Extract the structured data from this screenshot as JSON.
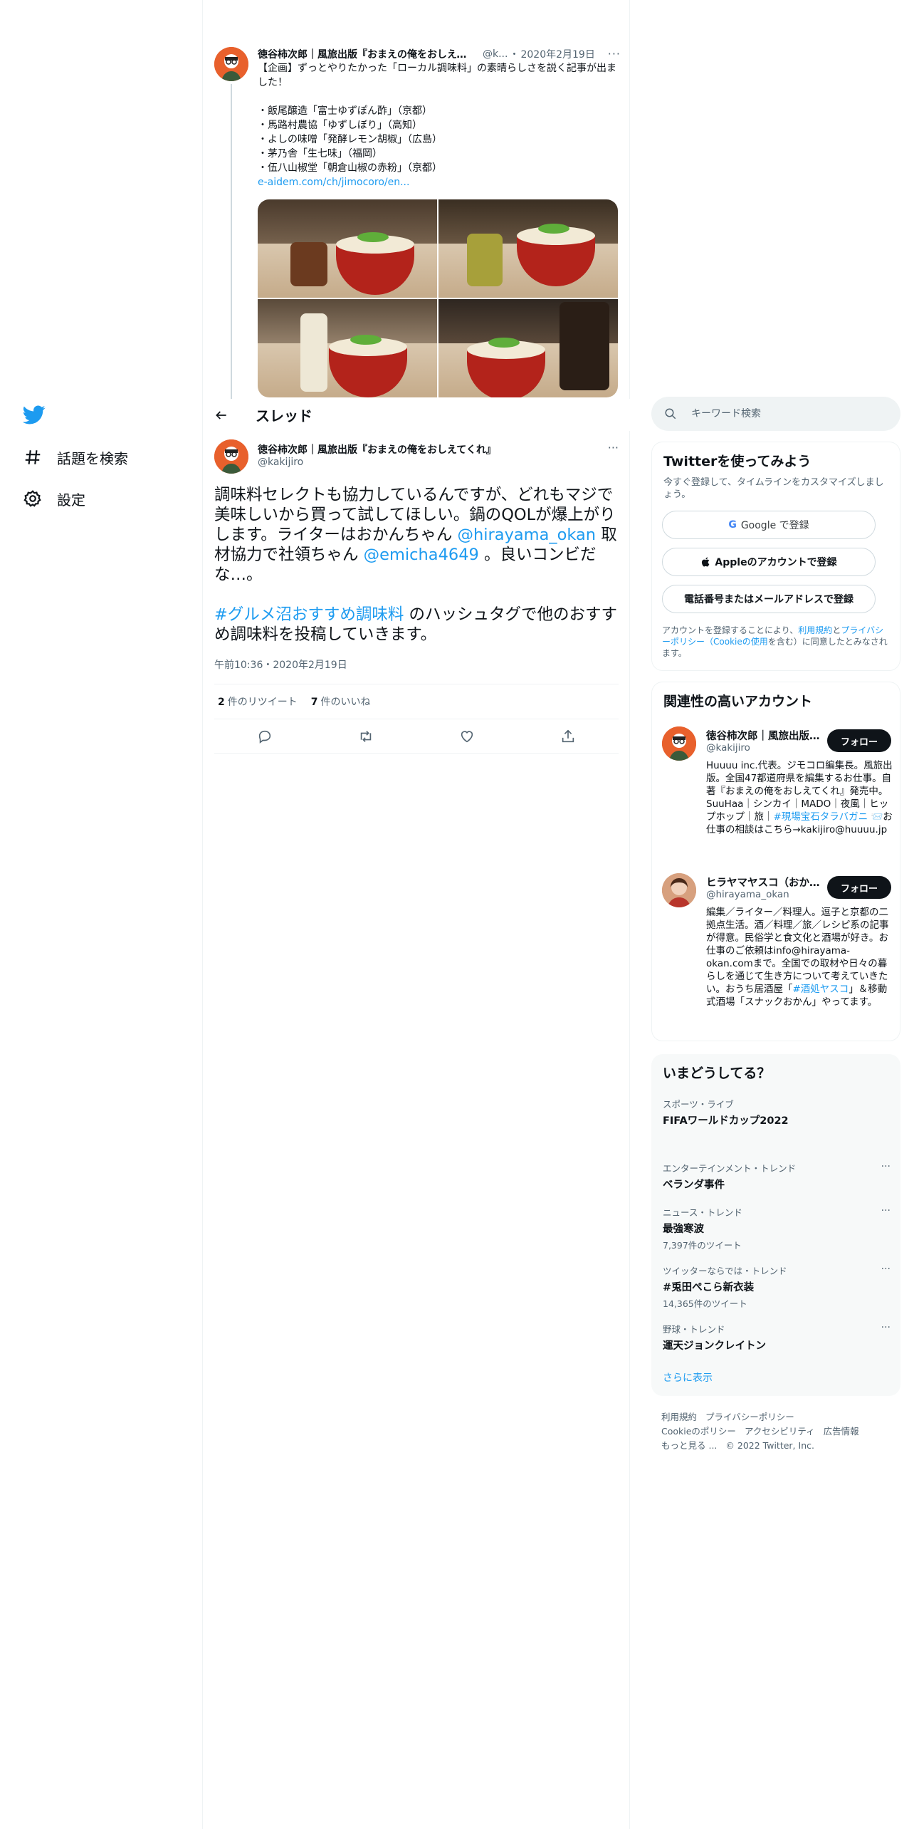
{
  "nav": {
    "items": [
      {
        "label": "話題を検索",
        "icon": "hashtag-icon"
      },
      {
        "label": "設定",
        "icon": "gear-icon"
      }
    ]
  },
  "parent_tweet": {
    "name": "徳谷柿次郎｜風旅出版『おまえの俺をおしえてくれ』",
    "handle": "@k...",
    "separator": "・",
    "date": "2020年2月19日",
    "more": "···",
    "text": "【企画】ずっとやりたかった「ローカル調味料」の素晴らしさを説く記事が出ました！\n\n・飯尾醸造「富士ゆずぽん酢」（京都）\n・馬路村農協「ゆずしぼり」（高知）\n・よしの味噌「発酵レモン胡椒」（広島）\n・茅乃舎「生七味」（福岡）\n・伍八山椒堂「朝倉山椒の赤粉」（京都）",
    "link": "e-aidem.com/ch/jimocoro/en..."
  },
  "header": {
    "title": "スレッド"
  },
  "main_tweet": {
    "name": "徳谷柿次郎｜風旅出版『おまえの俺をおしえてくれ』",
    "handle": "@kakijiro",
    "more": "···",
    "text_p1_a": "調味料セレクトも協力しているんですが、どれもマジで美味しいから買って試してほしい。鍋のQOLが爆上がりします。ライターはおかんちゃん ",
    "mention1": "@hirayama_okan",
    "text_p1_b": " 取材協力で社領ちゃん ",
    "mention2": "@emicha4649",
    "text_p1_c": " 。良いコンビだな…。",
    "hashtag": "#グルメ沼おすすめ調味料",
    "text_p2": " のハッシュタグで他のおすすめ調味料を投稿していきます。",
    "time": "午前10:36",
    "separator": "・",
    "date": "2020年2月19日",
    "retweets": "2",
    "retweets_label": "件のリツイート",
    "likes": "7",
    "likes_label": "件のいいね"
  },
  "search": {
    "placeholder": "キーワード検索"
  },
  "signup": {
    "title": "Twitterを使ってみよう",
    "subtitle": "今すぐ登録して、タイムラインをカスタマイズしましょう。",
    "google_logo": "G",
    "google": "Google で登録",
    "apple": "Appleのアカウントで登録",
    "phone": "電話番号またはメールアドレスで登録",
    "terms_a": "アカウントを登録することにより、",
    "terms_link1": "利用規約",
    "terms_b": "と",
    "terms_link2": "プライバシーポリシー（Cookieの使用",
    "terms_c": "を含む）に同意したとみなされます。"
  },
  "related": {
    "title": "関連性の高いアカウント",
    "follow": "フォロー",
    "accounts": [
      {
        "name": "徳谷柿次郎｜風旅出版『おまえの俺をおしえてくれ』",
        "handle": "@kakijiro",
        "bio_a": "Huuuu inc.代表。ジモコロ編集長。風旅出版。全国47都道府県を編集するお仕事。自著『おまえの俺をおしえてくれ』発売中。SuuHaa｜シンカイ｜MADO｜夜風｜ヒップホップ｜旅｜",
        "bio_tag": "#現場宝石タラバガニ",
        "bio_b": " 📨お仕事の相談はこちら→kakijiro@huuuu.jp"
      },
      {
        "name": "ヒラヤマヤスコ（おかん）",
        "handle": "@hirayama_okan",
        "bio_a": "編集／ライター／料理人。逗子と京都の二拠点生活。酒／料理／旅／レシピ系の記事が得意。民俗学と食文化と酒場が好き。お仕事のご依頼はinfo@hirayama-okan.comまで。全国での取材や日々の暮らしを通じて生き方について考えていきたい。おうち居酒屋「",
        "bio_tag": "#酒処ヤスコ",
        "bio_b": "」＆移動式酒場「スナックおかん」やってます。"
      }
    ]
  },
  "trends": {
    "title": "いまどうしてる？",
    "more": "···",
    "items": [
      {
        "category": "スポーツ・ライブ",
        "name": "FIFAワールドカップ2022",
        "count": ""
      },
      {
        "category": "エンターテインメント・トレンド",
        "name": "ベランダ事件",
        "count": ""
      },
      {
        "category": "ニュース・トレンド",
        "name": "最強寒波",
        "count": "7,397件のツイート"
      },
      {
        "category": "ツイッターならでは・トレンド",
        "name": "#兎田ぺこら新衣装",
        "count": "14,365件のツイート"
      },
      {
        "category": "野球・トレンド",
        "name": "運天ジョンクレイトン",
        "count": ""
      }
    ],
    "show_more": "さらに表示"
  },
  "footer": {
    "links": [
      "利用規約",
      "プライバシーポリシー",
      "Cookieのポリシー",
      "アクセシビリティ",
      "広告情報",
      "もっと見る ..."
    ],
    "copyright": "© 2022 Twitter, Inc."
  },
  "colors": {
    "accent": "#1d9bf0",
    "text": "#0f1419",
    "muted": "#536471",
    "border": "#eff3f4"
  }
}
